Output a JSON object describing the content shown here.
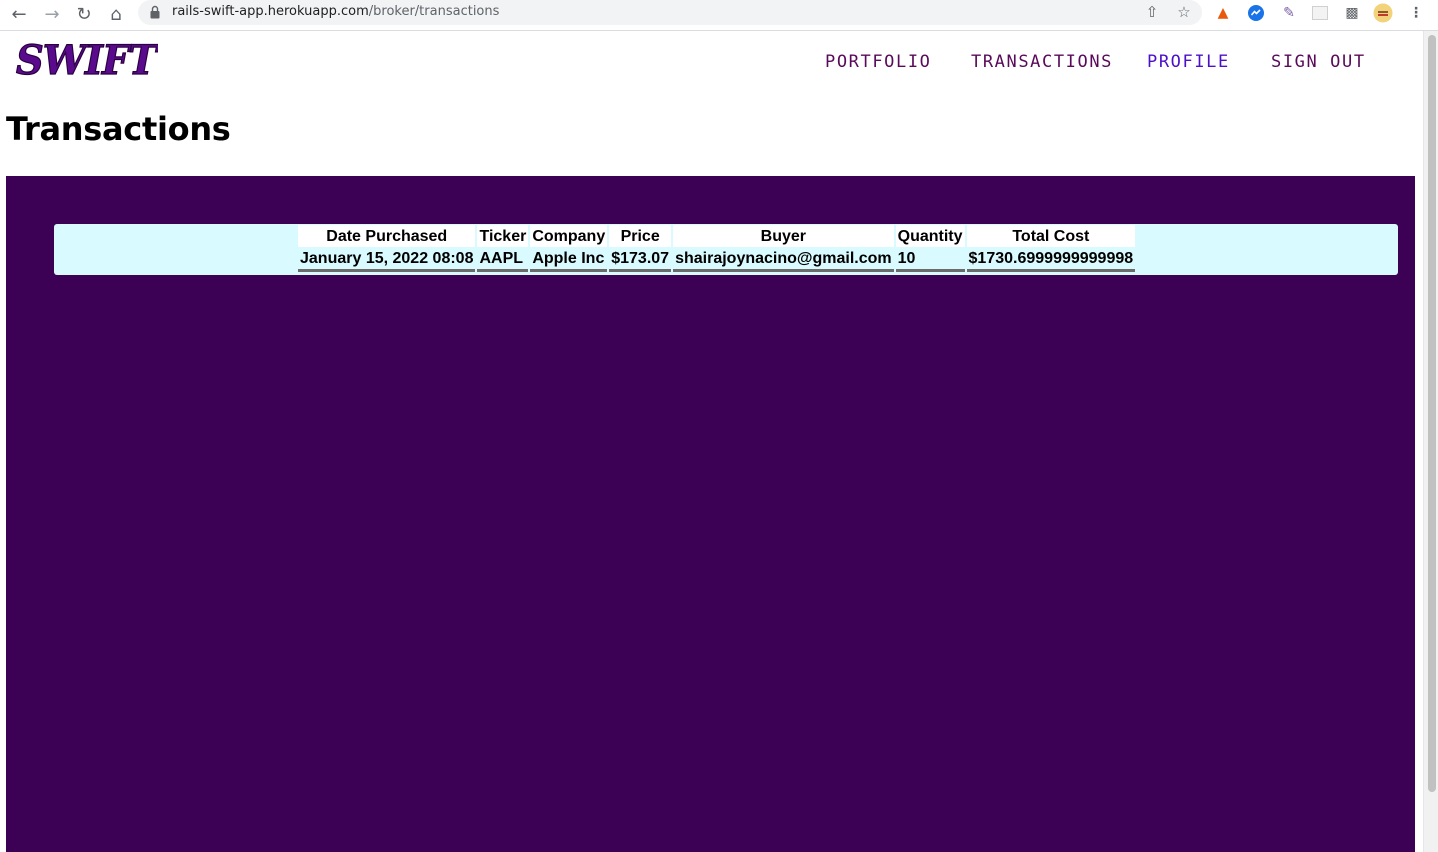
{
  "browser": {
    "url_host": "rails-swift-app.herokuapp.com",
    "url_path": "/broker/transactions"
  },
  "header": {
    "logo_text": "SWIFT",
    "nav": [
      {
        "label": "PORTFOLIO"
      },
      {
        "label": "TRANSACTIONS"
      },
      {
        "label": "PROFILE"
      },
      {
        "label": "SIGN OUT"
      }
    ]
  },
  "page": {
    "title": "Transactions"
  },
  "table": {
    "headers": [
      "Date Purchased",
      "Ticker",
      "Company",
      "Price",
      "Buyer",
      "Quantity",
      "Total Cost"
    ],
    "rows": [
      [
        "January 15, 2022 08:08",
        "AAPL",
        "Apple Inc",
        "$173.07",
        "shairajoynacino@gmail.com",
        "10",
        "$1730.6999999999998"
      ]
    ]
  },
  "colors": {
    "panel": "#3c0055",
    "table_bg": "#d9fbff",
    "nav_text": "#5a0a5a",
    "nav_active": "#4b10c8",
    "logo": "#5a0a8c"
  }
}
